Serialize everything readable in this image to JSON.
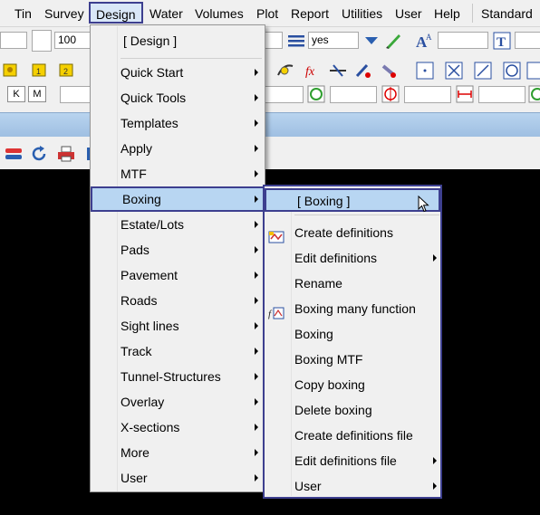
{
  "menubar": {
    "items": [
      "Tin",
      "Survey",
      "Design",
      "Water",
      "Volumes",
      "Plot",
      "Report",
      "Utilities",
      "User",
      "Help",
      "Standard"
    ],
    "active": "Design"
  },
  "toolbar1": {
    "field_value": "100",
    "select_value": "yes"
  },
  "toolbar3": {
    "k_label": "K",
    "m_label": "M"
  },
  "design_menu": {
    "header": "[ Design ]",
    "items": [
      {
        "label": "Quick Start",
        "submenu": true
      },
      {
        "label": "Quick Tools",
        "submenu": true
      },
      {
        "label": "Templates",
        "submenu": true
      },
      {
        "label": "Apply",
        "submenu": true
      },
      {
        "label": "MTF",
        "submenu": true
      },
      {
        "label": "Boxing",
        "submenu": true,
        "highlighted": true
      },
      {
        "label": "Estate/Lots",
        "submenu": true
      },
      {
        "label": "Pads",
        "submenu": true
      },
      {
        "label": "Pavement",
        "submenu": true
      },
      {
        "label": "Roads",
        "submenu": true
      },
      {
        "label": "Sight lines",
        "submenu": true
      },
      {
        "label": "Track",
        "submenu": true
      },
      {
        "label": "Tunnel-Structures",
        "submenu": true
      },
      {
        "label": "Overlay",
        "submenu": true
      },
      {
        "label": "X-sections",
        "submenu": true
      },
      {
        "label": "More",
        "submenu": true
      },
      {
        "label": "User",
        "submenu": true
      }
    ]
  },
  "boxing_menu": {
    "header": "[ Boxing ]",
    "items": [
      {
        "label": "Create definitions",
        "submenu": false,
        "icon": "boxing-create-icon"
      },
      {
        "label": "Edit definitions",
        "submenu": true
      },
      {
        "label": "Rename",
        "submenu": false
      },
      {
        "label": "Boxing many function",
        "submenu": false,
        "icon": "boxing-function-icon"
      },
      {
        "label": "Boxing",
        "submenu": false
      },
      {
        "label": "Boxing MTF",
        "submenu": false
      },
      {
        "label": "Copy boxing",
        "submenu": false
      },
      {
        "label": "Delete boxing",
        "submenu": false
      },
      {
        "label": "Create definitions file",
        "submenu": false
      },
      {
        "label": "Edit definitions file",
        "submenu": true
      },
      {
        "label": "User",
        "submenu": true
      }
    ]
  },
  "colors": {
    "highlight_border": "#3d3f8f",
    "highlight_fill": "#b8d6f2",
    "menu_bg": "#f0f0f0"
  }
}
